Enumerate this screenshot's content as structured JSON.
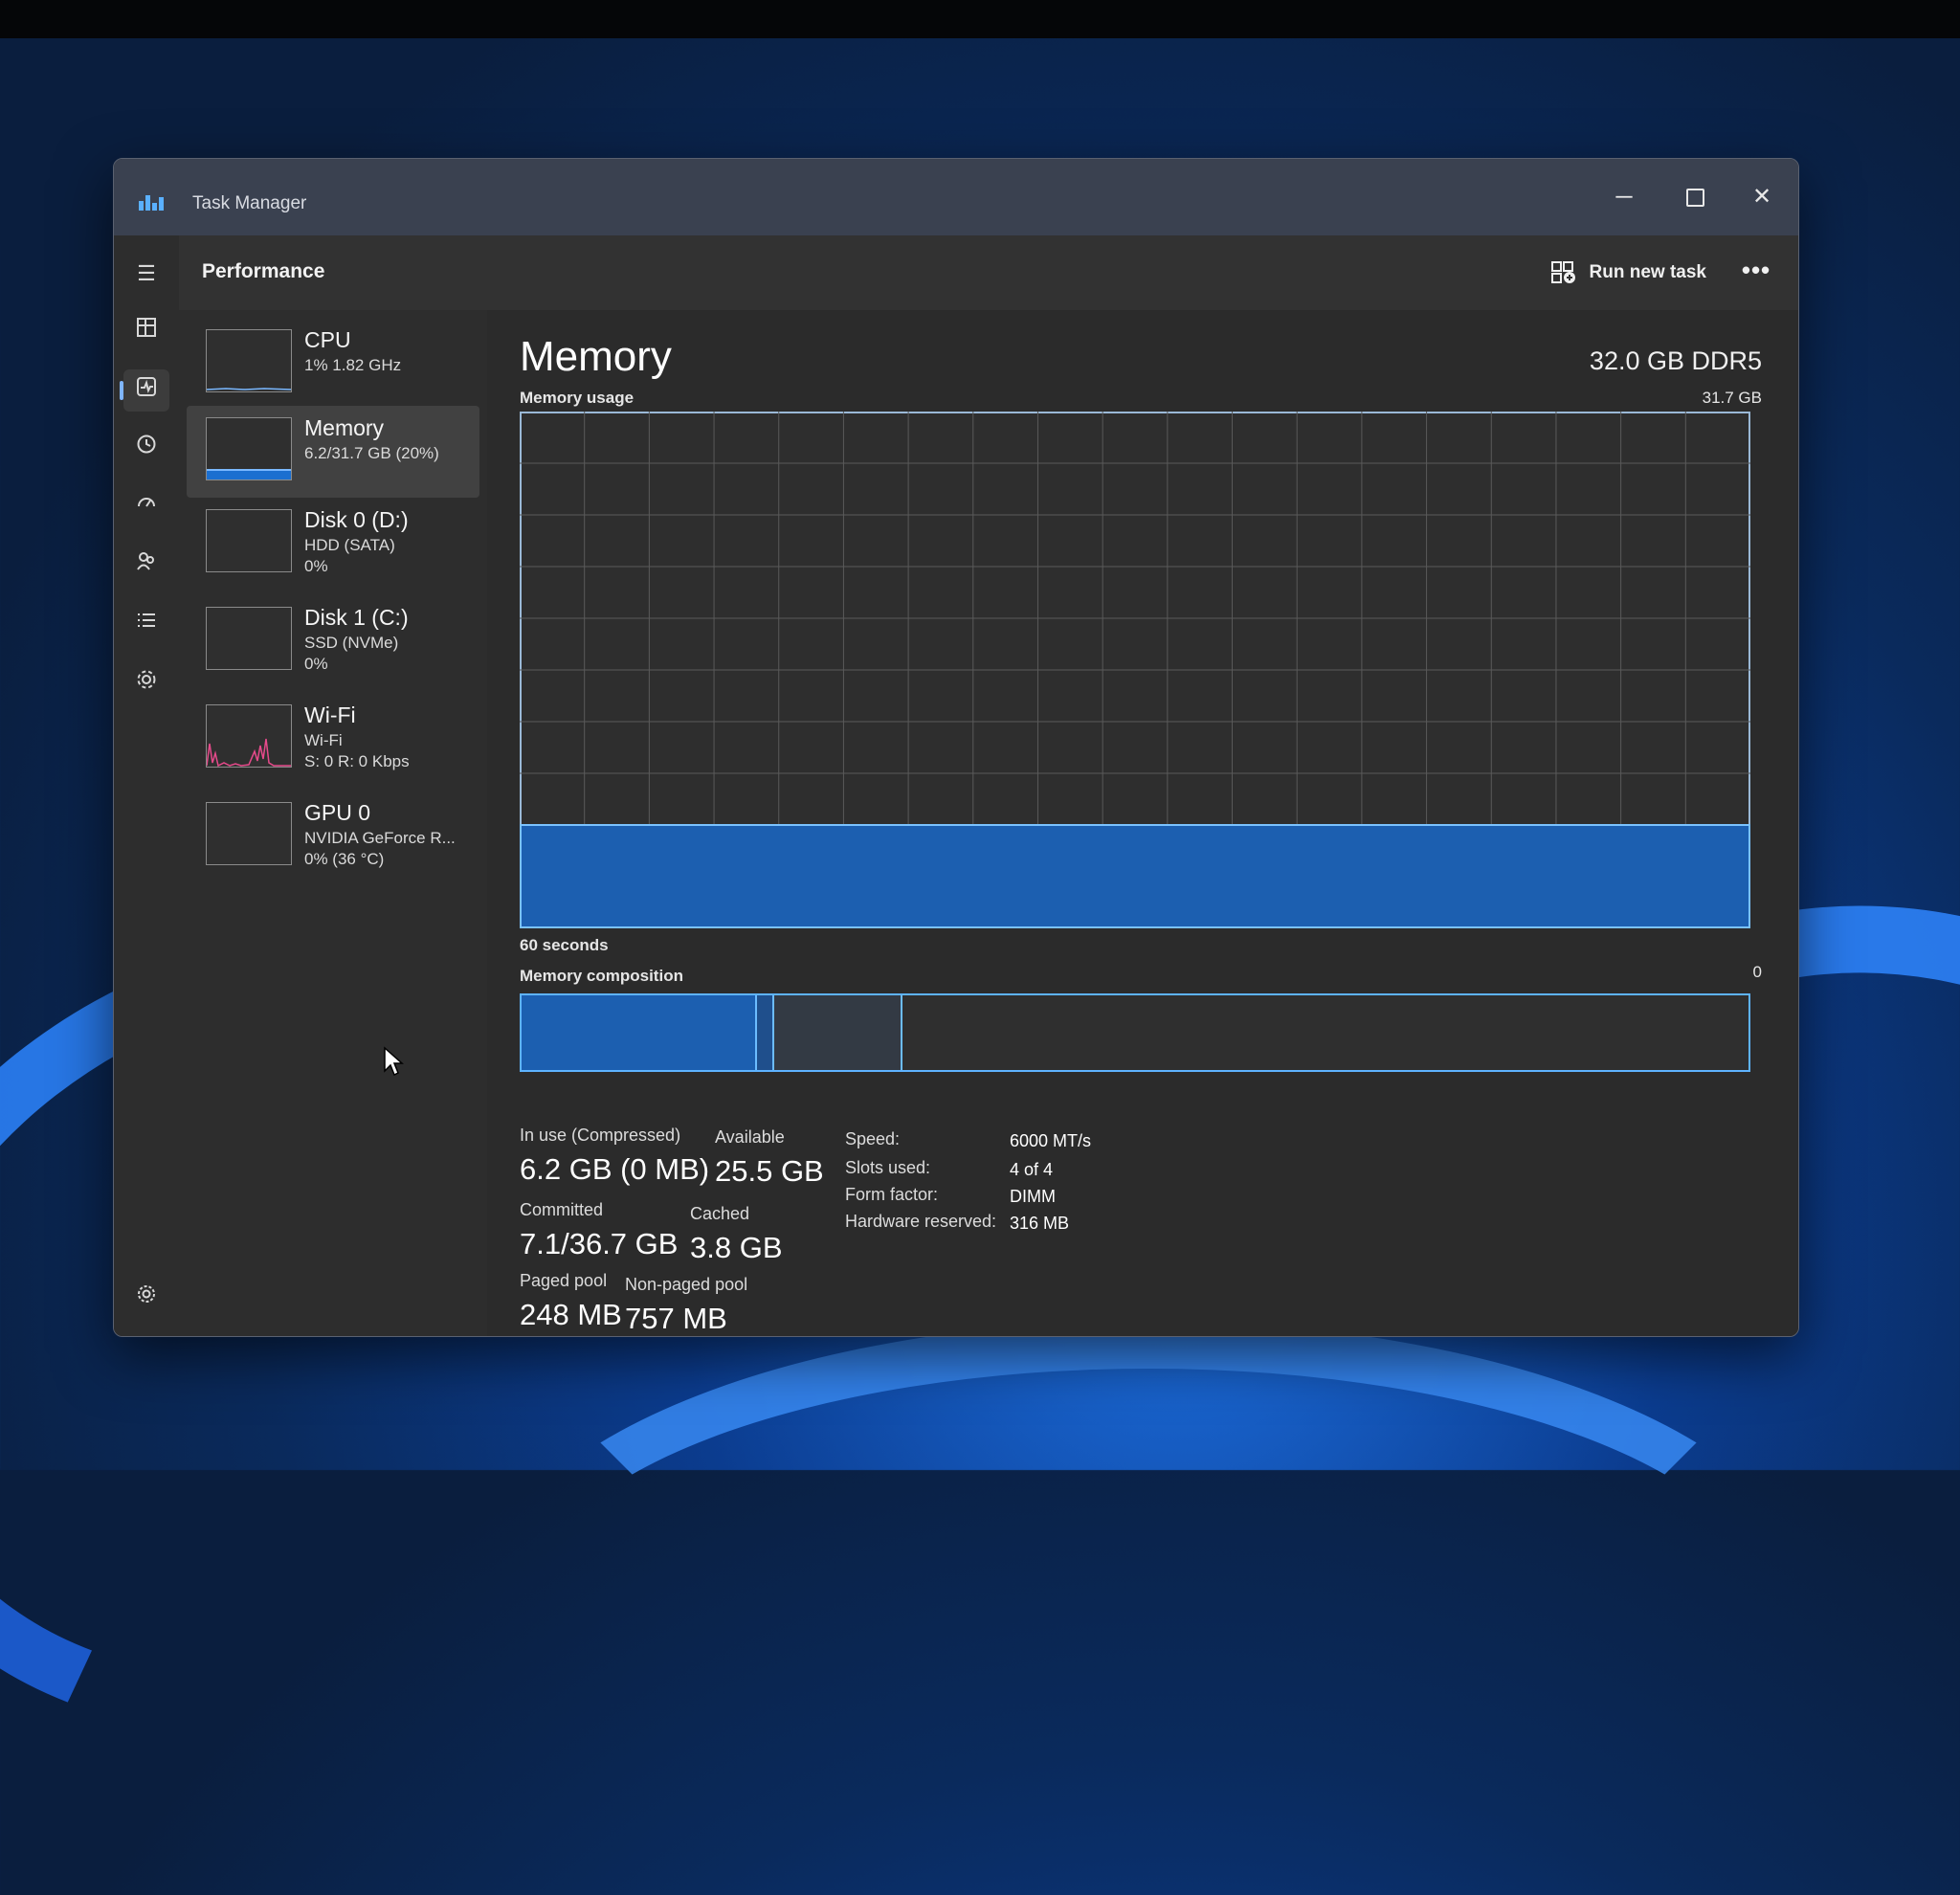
{
  "window": {
    "title": "Task Manager"
  },
  "header": {
    "title": "Performance",
    "run_new_task": "Run new task",
    "more": "•••"
  },
  "rail": [
    "menu-icon",
    "processes-icon",
    "performance-icon",
    "app-history-icon",
    "startup-icon",
    "users-icon",
    "details-icon",
    "services-icon",
    "settings-icon"
  ],
  "devices": [
    {
      "name": "CPU",
      "sub1": "1% 1.82 GHz",
      "sub2": ""
    },
    {
      "name": "Memory",
      "sub1": "6.2/31.7 GB (20%)",
      "sub2": ""
    },
    {
      "name": "Disk 0 (D:)",
      "sub1": "HDD (SATA)",
      "sub2": "0%"
    },
    {
      "name": "Disk 1 (C:)",
      "sub1": "SSD (NVMe)",
      "sub2": "0%"
    },
    {
      "name": "Wi-Fi",
      "sub1": "Wi-Fi",
      "sub2": "S: 0 R: 0 Kbps"
    },
    {
      "name": "GPU 0",
      "sub1": "NVIDIA GeForce R...",
      "sub2": "0% (36 °C)"
    }
  ],
  "memory": {
    "title": "Memory",
    "spec": "32.0 GB DDR5",
    "usage_label": "Memory usage",
    "usage_max": "31.7 GB",
    "time_label": "60 seconds",
    "zero_label": "0",
    "composition_label": "Memory composition",
    "in_use_label": "In use (Compressed)",
    "in_use_value": "6.2 GB (0 MB)",
    "available_label": "Available",
    "available_value": "25.5 GB",
    "committed_label": "Committed",
    "committed_value": "7.1/36.7 GB",
    "cached_label": "Cached",
    "cached_value": "3.8 GB",
    "paged_label": "Paged pool",
    "paged_value": "248 MB",
    "nonpaged_label": "Non-paged pool",
    "nonpaged_value": "757 MB",
    "speed_key": "Speed:",
    "speed_val": "6000 MT/s",
    "slots_key": "Slots used:",
    "slots_val": "4 of 4",
    "form_key": "Form factor:",
    "form_val": "DIMM",
    "hw_key": "Hardware reserved:",
    "hw_val": "316 MB",
    "usage_fraction": 0.2
  },
  "colors": {
    "accent": "#5eb3ff",
    "fill": "#1c5fb0"
  }
}
